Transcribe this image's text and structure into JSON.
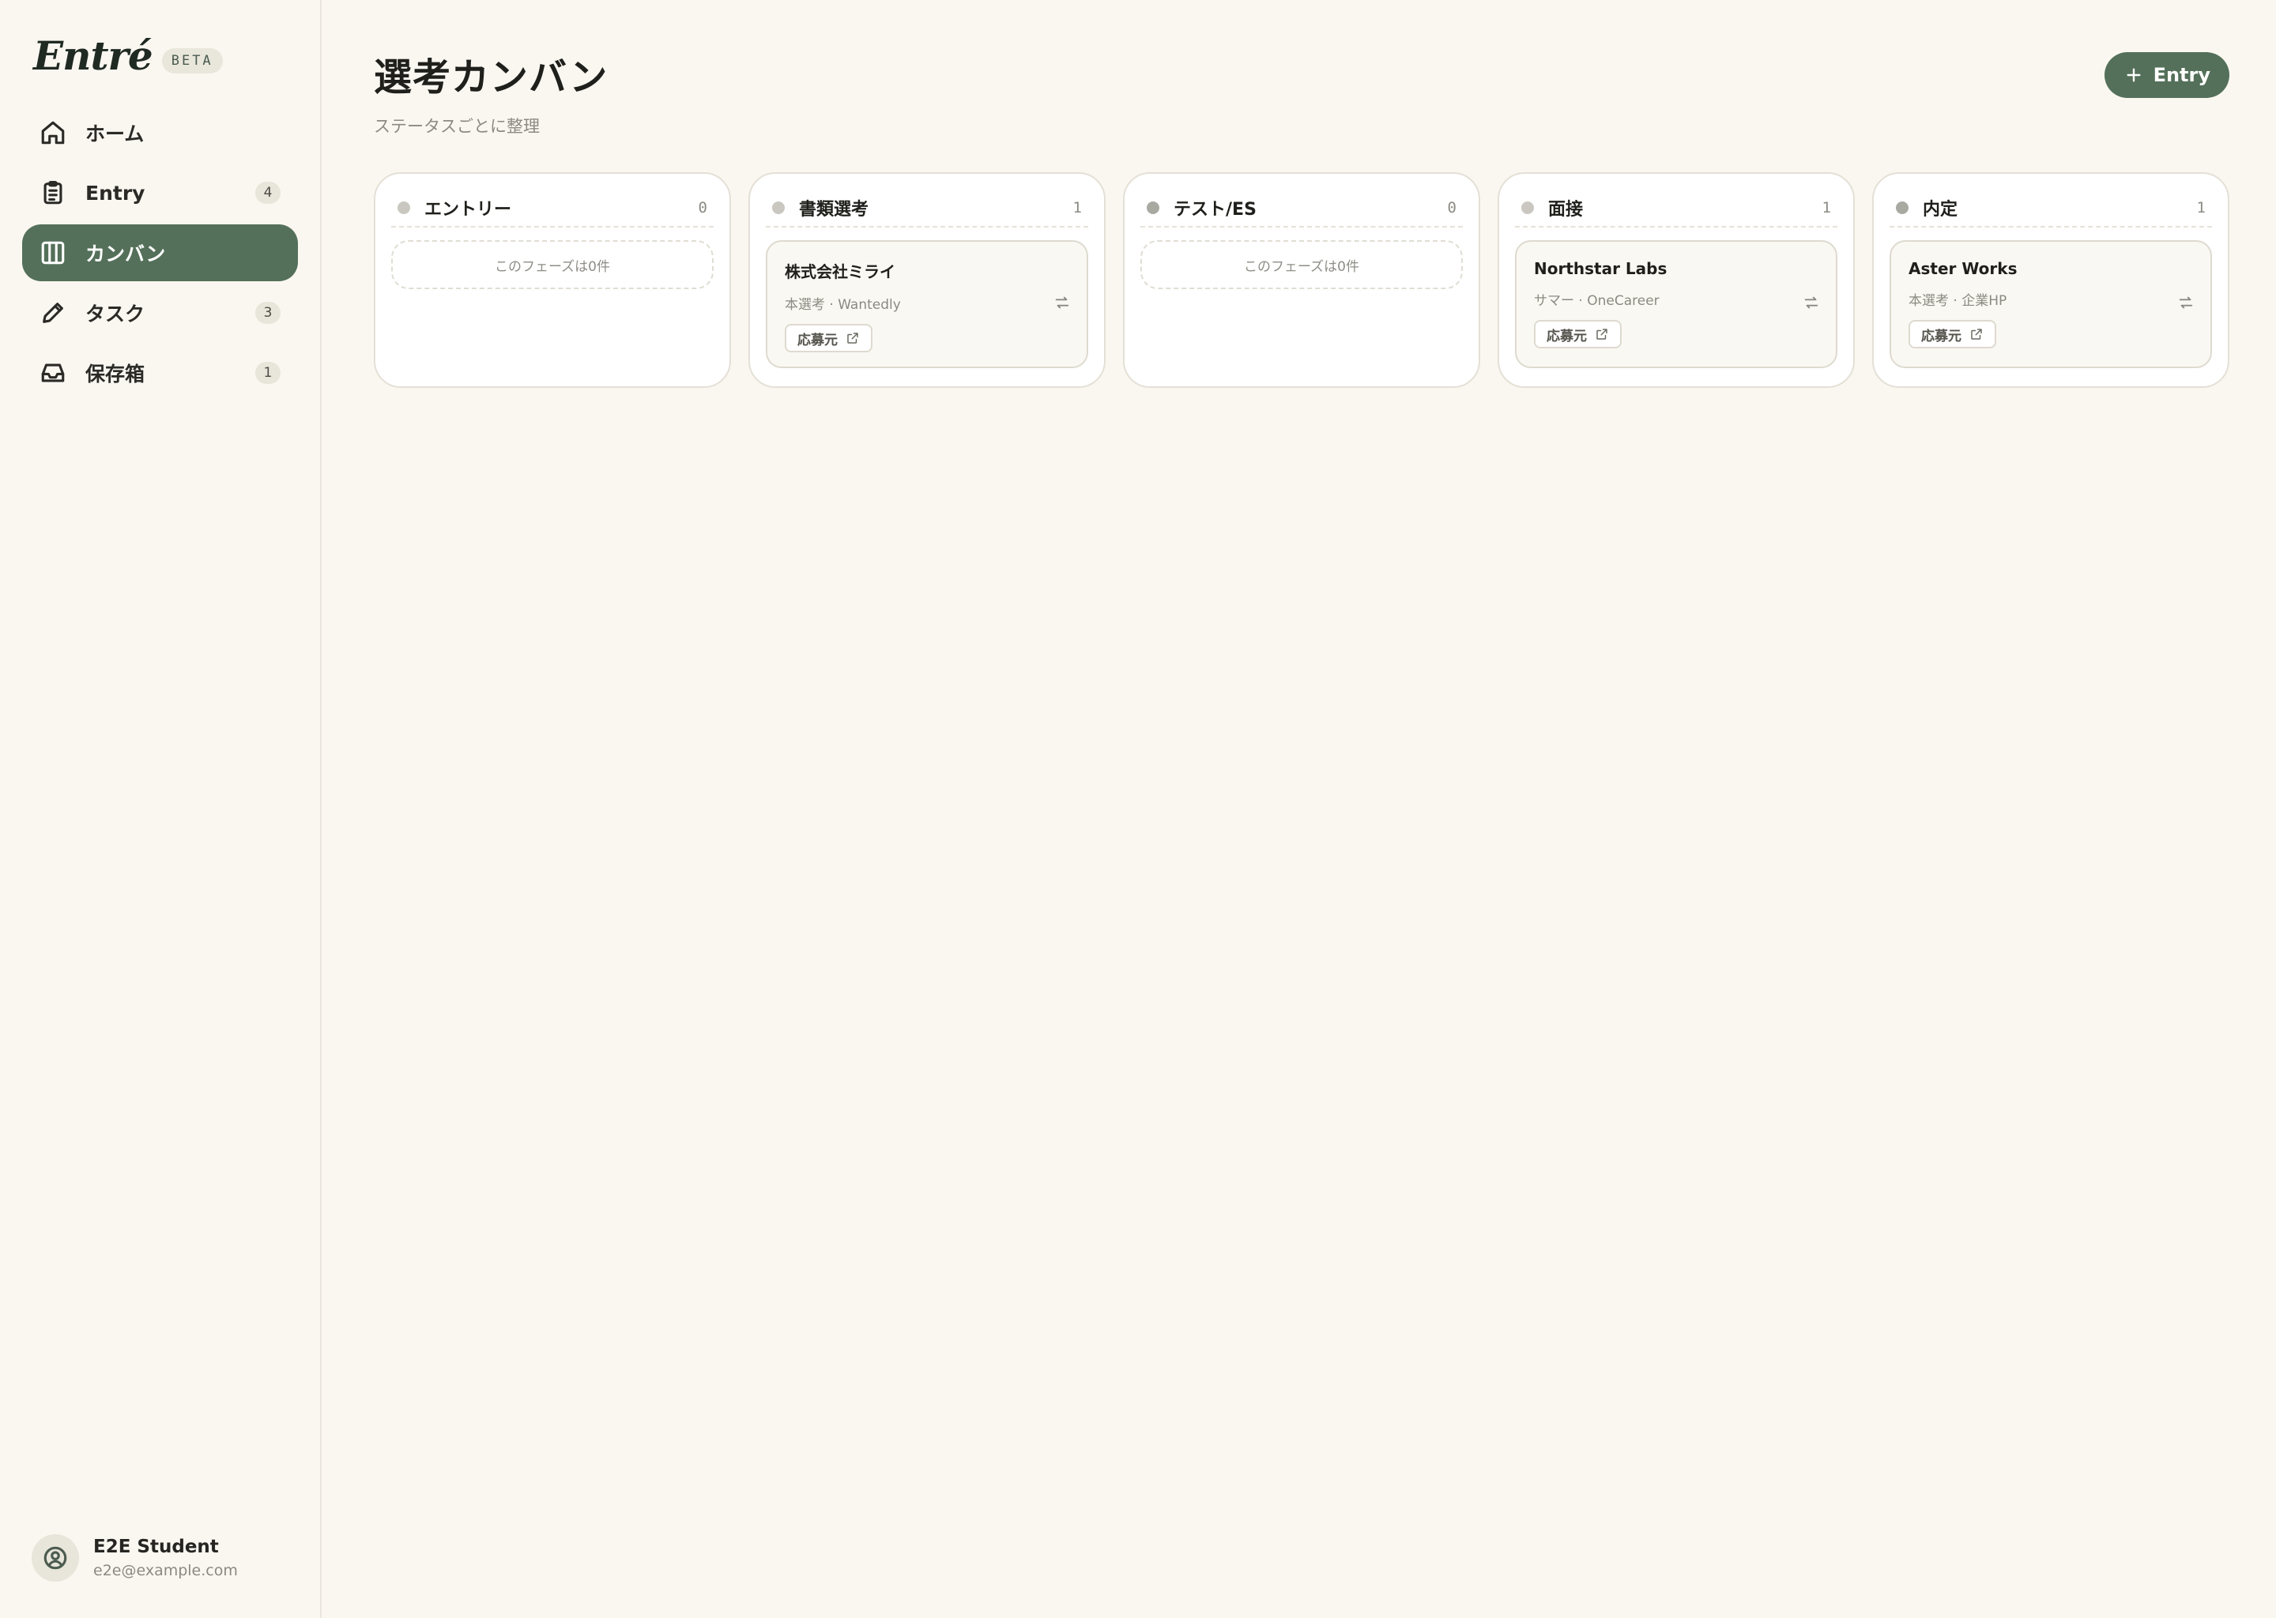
{
  "brand": {
    "name": "Entré",
    "badge": "BETA"
  },
  "sidebar": {
    "items": [
      {
        "label": "ホーム",
        "icon": "home-icon",
        "count": null
      },
      {
        "label": "Entry",
        "icon": "clipboard-icon",
        "count": "4"
      },
      {
        "label": "カンバン",
        "icon": "kanban-icon",
        "count": null,
        "active": true
      },
      {
        "label": "タスク",
        "icon": "pencil-icon",
        "count": "3"
      },
      {
        "label": "保存箱",
        "icon": "inbox-icon",
        "count": "1"
      }
    ]
  },
  "user": {
    "name": "E2E Student",
    "email": "e2e@example.com"
  },
  "page": {
    "title": "選考カンバン",
    "subtitle": "ステータスごとに整理",
    "entry_button": "Entry"
  },
  "columns": [
    {
      "title": "エントリー",
      "count": "0",
      "empty_text": "このフェーズは0件"
    },
    {
      "title": "書類選考",
      "count": "1",
      "card": {
        "title": "株式会社ミライ",
        "meta": "本選考 · Wantedly",
        "link": "応募元"
      }
    },
    {
      "title": "テスト/ES",
      "count": "0",
      "empty_text": "このフェーズは0件"
    },
    {
      "title": "面接",
      "count": "1",
      "card": {
        "title": "Northstar Labs",
        "meta": "サマー · OneCareer",
        "link": "応募元"
      }
    },
    {
      "title": "内定",
      "count": "1",
      "card": {
        "title": "Aster Works",
        "meta": "本選考 · 企業HP",
        "link": "応募元"
      }
    }
  ],
  "colors": {
    "accent": "#54705a",
    "background": "#faf7f1"
  }
}
